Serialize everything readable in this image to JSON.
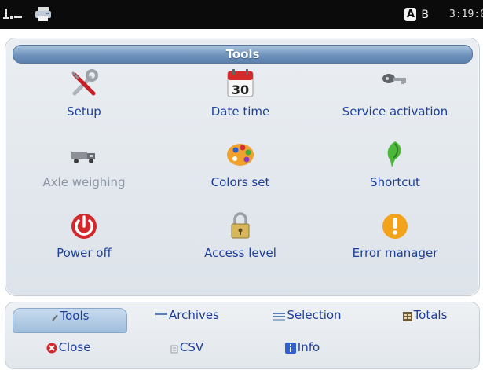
{
  "status_bar": {
    "badge_a": "A",
    "badge_b": "B",
    "time": "3:19:0"
  },
  "panel": {
    "title": "Tools",
    "tools": [
      {
        "label": "Setup",
        "icon": "wrench-screwdriver-icon",
        "enabled": true
      },
      {
        "label": "Date time",
        "icon": "calendar-icon",
        "calendar_day": "30",
        "enabled": true
      },
      {
        "label": "Service activation",
        "icon": "key-icon",
        "enabled": true
      },
      {
        "label": "Axle weighing",
        "icon": "truck-icon",
        "enabled": false
      },
      {
        "label": "Colors set",
        "icon": "palette-icon",
        "enabled": true
      },
      {
        "label": "Shortcut",
        "icon": "leaf-arrow-icon",
        "enabled": true
      },
      {
        "label": "Power off",
        "icon": "power-icon",
        "enabled": true
      },
      {
        "label": "Access level",
        "icon": "padlock-icon",
        "enabled": true
      },
      {
        "label": "Error manager",
        "icon": "warning-icon",
        "enabled": true
      }
    ]
  },
  "bottom_tabs": {
    "tools": "Tools",
    "archives": "Archives",
    "selection": "Selection",
    "totals": "Totals",
    "close": "Close",
    "csv": "CSV",
    "info": "Info",
    "active": "Tools"
  },
  "colors": {
    "label_blue": "#1d3f9c",
    "disabled_gray": "#8d96a4",
    "title_bar_blue": "#6f93bd",
    "power_red": "#d3282b",
    "warning_orange": "#f3a21c"
  }
}
